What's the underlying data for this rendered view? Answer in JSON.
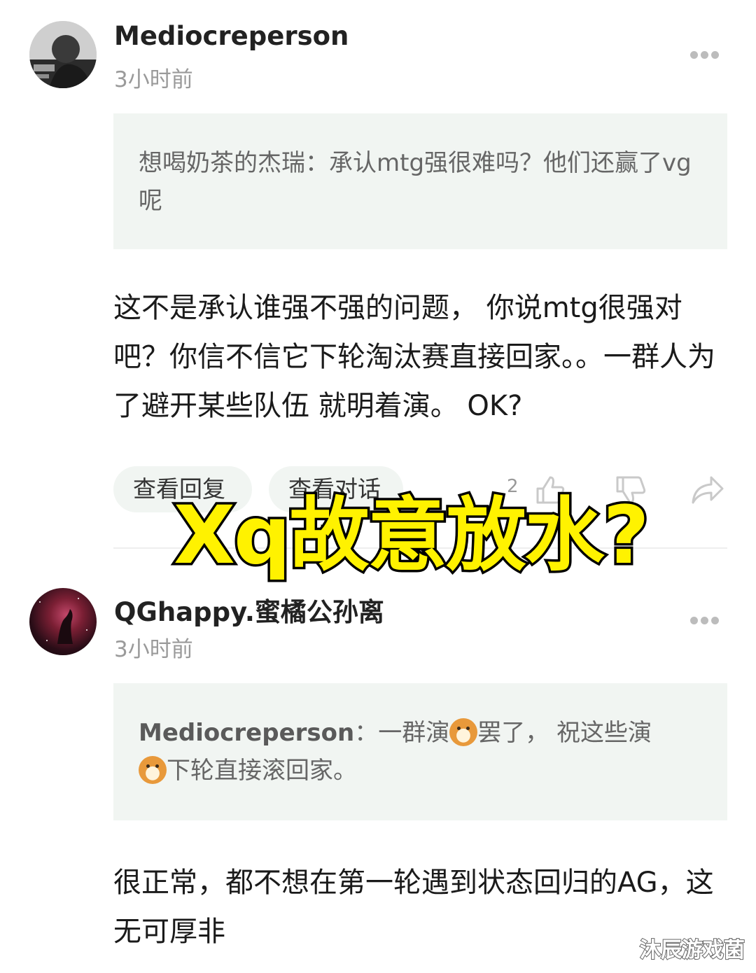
{
  "comments": [
    {
      "username": "Mediocreperson",
      "time": "3小时前",
      "quote_author": "想喝奶茶的杰瑞",
      "quote_text": "：承认mtg强很难吗？他们还赢了vg呢",
      "body": "这不是承认谁强不强的问题， 你说mtg很强对吧？你信不信它下轮淘汰赛直接回家。。一群人为了避开某些队伍 就明着演。 OK?",
      "actions": {
        "view_replies": "查看回复",
        "view_conversation": "查看对话",
        "like_count": "2"
      }
    },
    {
      "username": "QGhappy.蜜橘公孙离",
      "time": "3小时前",
      "quote_author": "Mediocreperson",
      "quote_text_part1": "：一群演",
      "quote_text_part2": "罢了， 祝这些演",
      "quote_text_part3": "下轮直接滚回家。",
      "body": "很正常，都不想在第一轮遇到状态回归的AG，这无可厚非"
    }
  ],
  "overlay_title": "Xq故意放水?",
  "watermark": "沐辰游戏菌",
  "icons": [
    "more-icon",
    "like-icon",
    "dislike-icon",
    "share-icon",
    "dog-emoji"
  ]
}
